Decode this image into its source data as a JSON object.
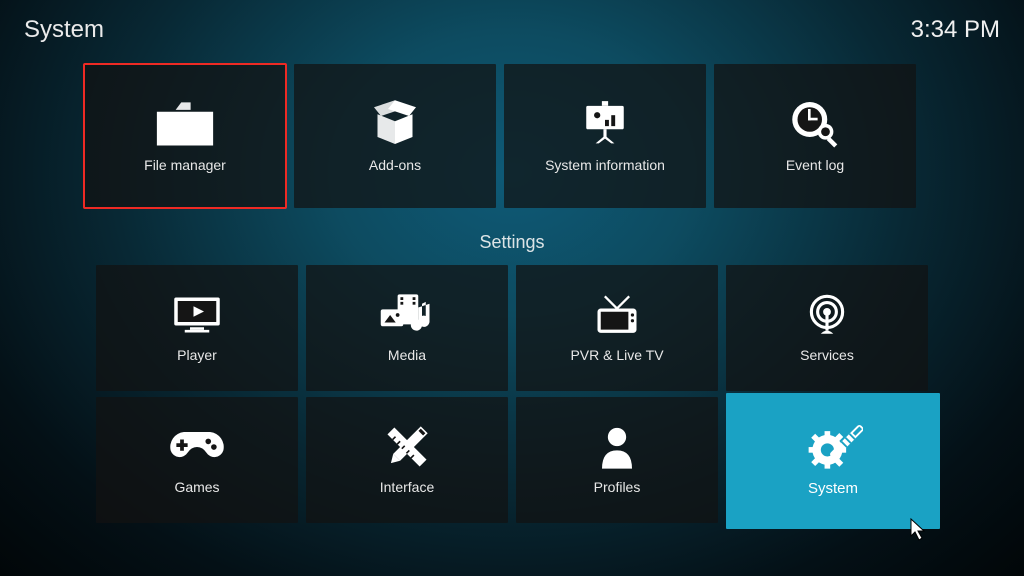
{
  "header": {
    "title": "System",
    "clock": "3:34 PM"
  },
  "section_label": "Settings",
  "row1": [
    {
      "key": "file-manager",
      "label": "File manager",
      "icon": "folder-icon",
      "highlighted": true
    },
    {
      "key": "addons",
      "label": "Add-ons",
      "icon": "open-box-icon"
    },
    {
      "key": "system-information",
      "label": "System information",
      "icon": "presentation-chart-icon"
    },
    {
      "key": "event-log",
      "label": "Event log",
      "icon": "clock-magnify-icon"
    }
  ],
  "row2": [
    {
      "key": "player",
      "label": "Player",
      "icon": "monitor-play-icon"
    },
    {
      "key": "media",
      "label": "Media",
      "icon": "media-collection-icon"
    },
    {
      "key": "pvr-live-tv",
      "label": "PVR & Live TV",
      "icon": "tv-antenna-icon"
    },
    {
      "key": "services",
      "label": "Services",
      "icon": "broadcast-icon"
    }
  ],
  "row3": [
    {
      "key": "games",
      "label": "Games",
      "icon": "gamepad-icon"
    },
    {
      "key": "interface",
      "label": "Interface",
      "icon": "pencil-ruler-icon"
    },
    {
      "key": "profiles",
      "label": "Profiles",
      "icon": "person-icon"
    },
    {
      "key": "system",
      "label": "System",
      "icon": "gear-wrench-icon",
      "selected": true
    }
  ]
}
